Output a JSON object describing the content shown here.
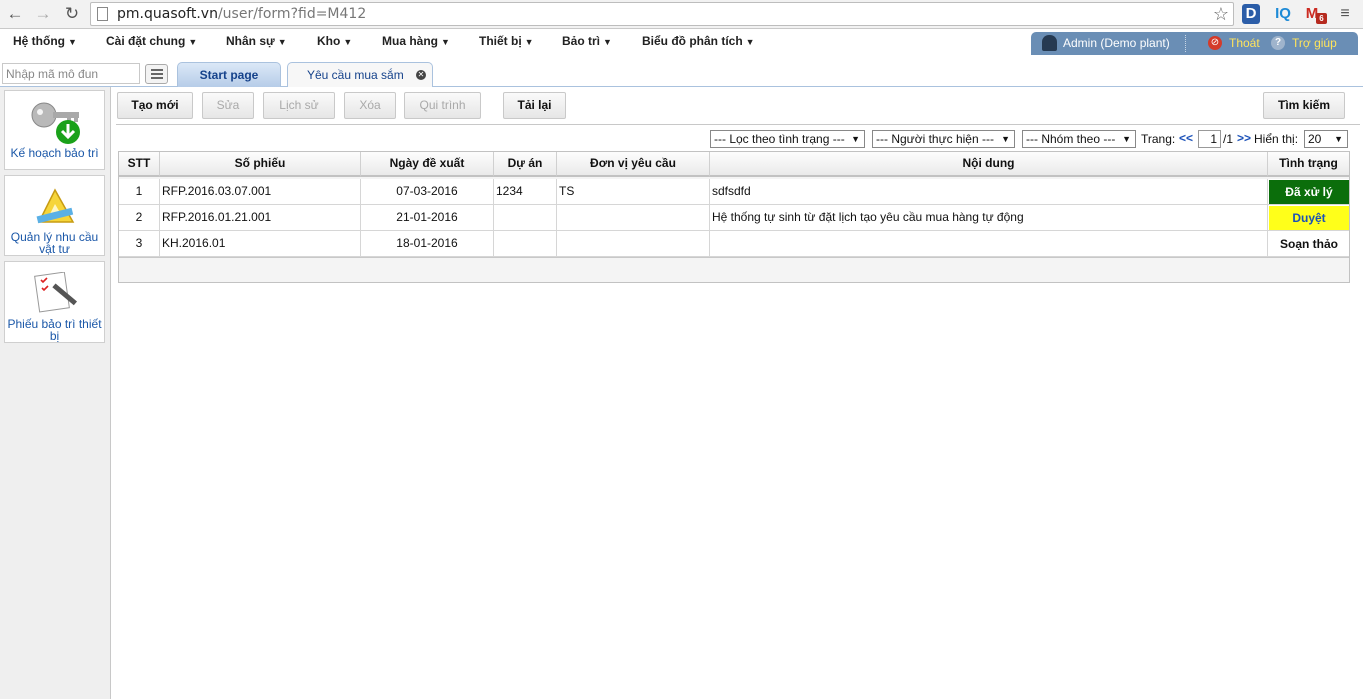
{
  "browser": {
    "url_host": "pm.quasoft.vn",
    "url_path": "/user/form?fid=M412",
    "ext_d": "D",
    "ext_iq": "IQ",
    "ext_mail": "M",
    "ext_mail_badge": "6"
  },
  "menu": {
    "items": [
      "Hệ thống",
      "Cài đặt chung",
      "Nhân sự",
      "Kho",
      "Mua hàng",
      "Thiết bị",
      "Bảo trì",
      "Biểu đồ phân tích"
    ]
  },
  "user": {
    "name": "Admin (Demo plant)",
    "logout": "Thoát",
    "help": "Trợ giúp"
  },
  "tabs": {
    "module_placeholder": "Nhập mã mô đun",
    "start_page": "Start page",
    "current": "Yêu cầu mua sắm"
  },
  "modules": [
    {
      "label_line1": "Kế hoạch bảo trì",
      "label_line2": ""
    },
    {
      "label_line1": "Quản lý nhu cầu",
      "label_line2": "vật tư"
    },
    {
      "label_line1": "Phiếu bảo trì thiết",
      "label_line2": "bị"
    }
  ],
  "toolbar": {
    "create": "Tạo mới",
    "edit": "Sửa",
    "history": "Lịch sử",
    "delete": "Xóa",
    "workflow": "Qui trình",
    "reload": "Tải lại",
    "search": "Tìm kiếm"
  },
  "filters": {
    "status": "--- Lọc theo tình trạng ---",
    "assignee": "--- Người thực hiện ---",
    "group": "--- Nhóm theo ---",
    "page_label": "Trang:",
    "prev": "<<",
    "page_value": "1",
    "page_total": "/1",
    "next": ">>",
    "show_label": "Hiển thị:",
    "show_value": "20"
  },
  "table": {
    "headers": [
      "STT",
      "Số phiếu",
      "Ngày đề xuất",
      "Dự án",
      "Đơn vị yêu cầu",
      "Nội dung",
      "Tình trạng"
    ],
    "rows": [
      {
        "stt": "1",
        "code": "RFP.2016.03.07.001",
        "date": "07-03-2016",
        "project": "1234",
        "unit": "TS",
        "content": "sdfsdfd",
        "status": "Đã xử lý"
      },
      {
        "stt": "2",
        "code": "RFP.2016.01.21.001",
        "date": "21-01-2016",
        "project": "",
        "unit": "",
        "content": "Hệ thống tự sinh từ đặt lịch tạo yêu cầu mua hàng tự động",
        "status": "Duyệt"
      },
      {
        "stt": "3",
        "code": "KH.2016.01",
        "date": "18-01-2016",
        "project": "",
        "unit": "",
        "content": "",
        "status": "Soạn thảo"
      }
    ]
  },
  "colors": {
    "status_done_bg": "#0b6e0b",
    "status_done_fg": "#ffffff",
    "status_approved_bg": "#ffff1a",
    "status_approved_fg": "#1a50b8",
    "status_draft_bg": "#ffffff",
    "status_draft_fg": "#111111"
  }
}
